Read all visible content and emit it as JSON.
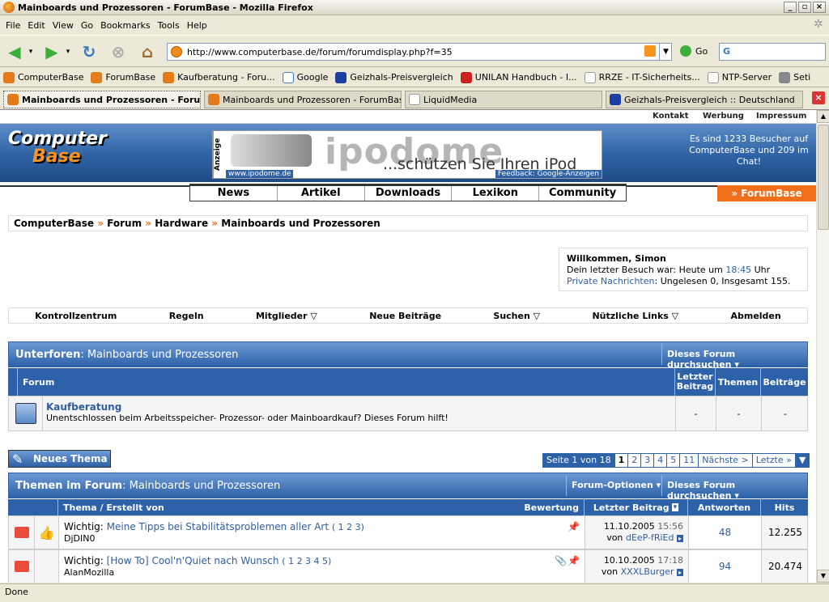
{
  "window": {
    "title": "Mainboards und Prozessoren - ForumBase - Mozilla Firefox"
  },
  "menu": [
    "File",
    "Edit",
    "View",
    "Go",
    "Bookmarks",
    "Tools",
    "Help"
  ],
  "url": "http://www.computerbase.de/forum/forumdisplay.php?f=35",
  "go_label": "Go",
  "bookmarks": [
    "ComputerBase",
    "ForumBase",
    "Kaufberatung - Foru...",
    "Google",
    "Geizhals-Preisvergleich",
    "UNILAN Handbuch - I...",
    "RRZE - IT-Sicherheits...",
    "NTP-Server",
    "Seti"
  ],
  "tabs": [
    "Mainboards und Prozessoren - Foru...",
    "Mainboards und Prozessoren - ForumBase",
    "LiquidMedia",
    "Geizhals-Preisvergleich :: Deutschland"
  ],
  "topnav": [
    "Kontakt",
    "Werbung",
    "Impressum"
  ],
  "logo": {
    "line1": "Computer",
    "line2": "Base"
  },
  "ad": {
    "side": "Anzeige",
    "brand": "ipodome",
    "slogan": "...schützen Sie Ihren iPod",
    "link1": "www.ipodome.de",
    "link2": "Feedback: Google-Anzeigen"
  },
  "visitors": "Es sind 1233 Besucher auf ComputerBase und 209 im Chat!",
  "mainnav": [
    "News",
    "Artikel",
    "Downloads",
    "Lexikon",
    "Community"
  ],
  "forumbase": "» ForumBase",
  "breadcrumb": [
    "ComputerBase",
    "Forum",
    "Hardware",
    "Mainboards und Prozessoren"
  ],
  "welcome": {
    "title": "Willkommen, Simon",
    "line1a": "Dein letzter Besuch war: Heute um",
    "time": "18:45",
    "line1b": "Uhr",
    "pm": "Private Nachrichten",
    "line2": ": Ungelesen 0, Insgesamt 155."
  },
  "usernav": [
    "Kontrollzentrum",
    "Regeln",
    "Mitglieder ▽",
    "Neue Beiträge",
    "Suchen ▽",
    "Nützliche Links ▽",
    "Abmelden"
  ],
  "subforums": {
    "title_b": "Unterforen",
    "title": ": Mainboards und Prozessoren",
    "search": "Dieses Forum durchsuchen ▾",
    "cols": [
      "Forum",
      "Letzter Beitrag",
      "Themen",
      "Beiträge"
    ],
    "rows": [
      {
        "name": "Kaufberatung",
        "desc": "Unentschlossen beim Arbeitsspeicher- Prozessor- oder Mainboardkauf? Dieses Forum hilft!",
        "last": "-",
        "topics": "-",
        "posts": "-"
      }
    ]
  },
  "newtopic": "Neues Thema",
  "pager": {
    "label": "Seite 1 von 18",
    "pages": [
      "1",
      "2",
      "3",
      "4",
      "5",
      "11"
    ],
    "next": "Nächste >",
    "last": "Letzte »"
  },
  "threads": {
    "title_b": "Themen im Forum",
    "title": ": Mainboards und Prozessoren",
    "options": "Forum-Optionen ▾",
    "search": "Dieses Forum durchsuchen ▾",
    "cols": [
      "Thema / Erstellt von",
      "Bewertung",
      "Letzter Beitrag",
      "Antworten",
      "Hits"
    ],
    "rows": [
      {
        "prefix": "Wichtig:",
        "title": "Meine Tipps bei Stabilitätsproblemen aller Art",
        "pages": "( 1 2 3)",
        "author": "DjDIN0",
        "date": "11.10.2005",
        "time": "15:56",
        "by": "von",
        "lastuser": "dEeP-fRiEd",
        "replies": "48",
        "hits": "12.255"
      },
      {
        "prefix": "Wichtig:",
        "title": "[How To] Cool'n'Quiet nach Wunsch",
        "pages": "( 1 2 3 4 5)",
        "author": "AlanMozilla",
        "date": "10.10.2005",
        "time": "17:18",
        "by": "von",
        "lastuser": "XXXLBurger",
        "replies": "94",
        "hits": "20.474"
      }
    ]
  },
  "status": "Done"
}
